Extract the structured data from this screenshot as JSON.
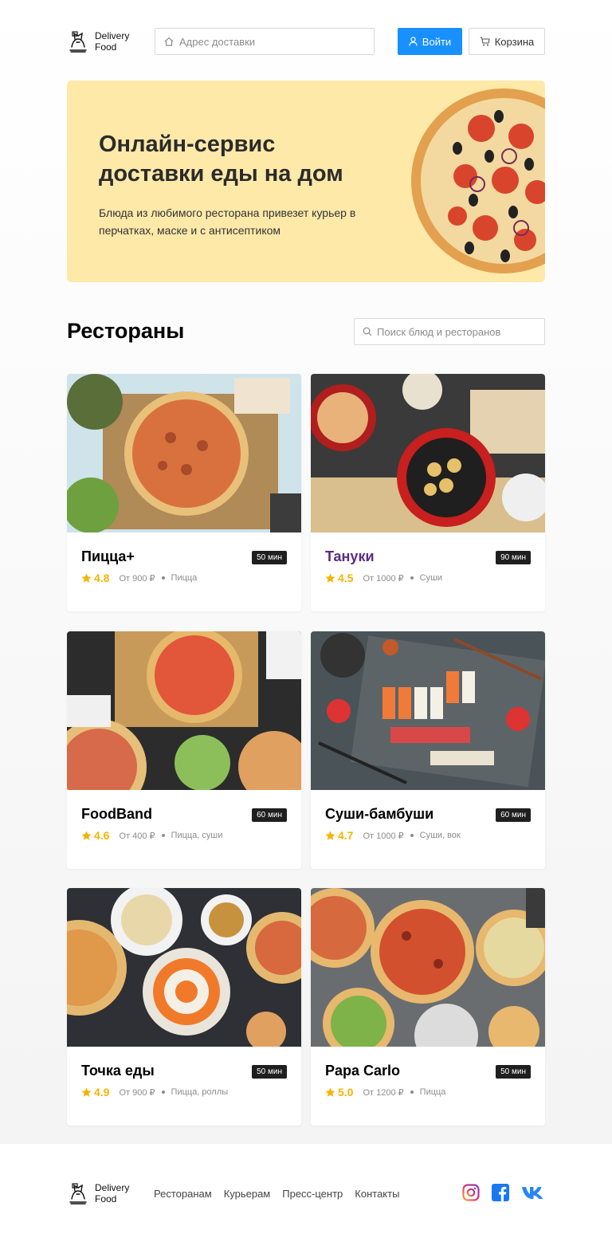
{
  "brand": {
    "line1": "Delivery",
    "line2": "Food"
  },
  "header": {
    "address_placeholder": "Адрес доставки",
    "login_label": "Войти",
    "cart_label": "Корзина"
  },
  "promo": {
    "title": "Онлайн-сервис доставки еды на дом",
    "text": "Блюда из любимого ресторана привезет курьер в перчатках, маске и с антисептиком"
  },
  "restaurants": {
    "heading": "Рестораны",
    "search_placeholder": "Поиск блюд и ресторанов",
    "items": [
      {
        "name": "Пицца+",
        "time": "50 мин",
        "rating": "4.8",
        "price": "От 900 ₽",
        "category": "Пицца"
      },
      {
        "name": "Тануки",
        "time": "90 мин",
        "rating": "4.5",
        "price": "От 1000 ₽",
        "category": "Суши"
      },
      {
        "name": "FoodBand",
        "time": "60 мин",
        "rating": "4.6",
        "price": "От 400 ₽",
        "category": "Пицца, суши"
      },
      {
        "name": "Суши-бамбуши",
        "time": "60 мин",
        "rating": "4.7",
        "price": "От 1000 ₽",
        "category": "Суши, вок"
      },
      {
        "name": "Точка еды",
        "time": "50 мин",
        "rating": "4.9",
        "price": "От 900 ₽",
        "category": "Пицца, роллы"
      },
      {
        "name": "Papa Carlo",
        "time": "50 мин",
        "rating": "5.0",
        "price": "От 1200 ₽",
        "category": "Пицца"
      }
    ]
  },
  "footer": {
    "nav": [
      "Ресторанам",
      "Курьерам",
      "Пресс-центр",
      "Контакты"
    ],
    "social": [
      "instagram-icon",
      "facebook-icon",
      "vk-icon"
    ]
  },
  "colors": {
    "primary": "#1890ff",
    "promo_bg": "#fee9a9",
    "rating": "#f5b400",
    "accent_title": "#5b2a86"
  }
}
